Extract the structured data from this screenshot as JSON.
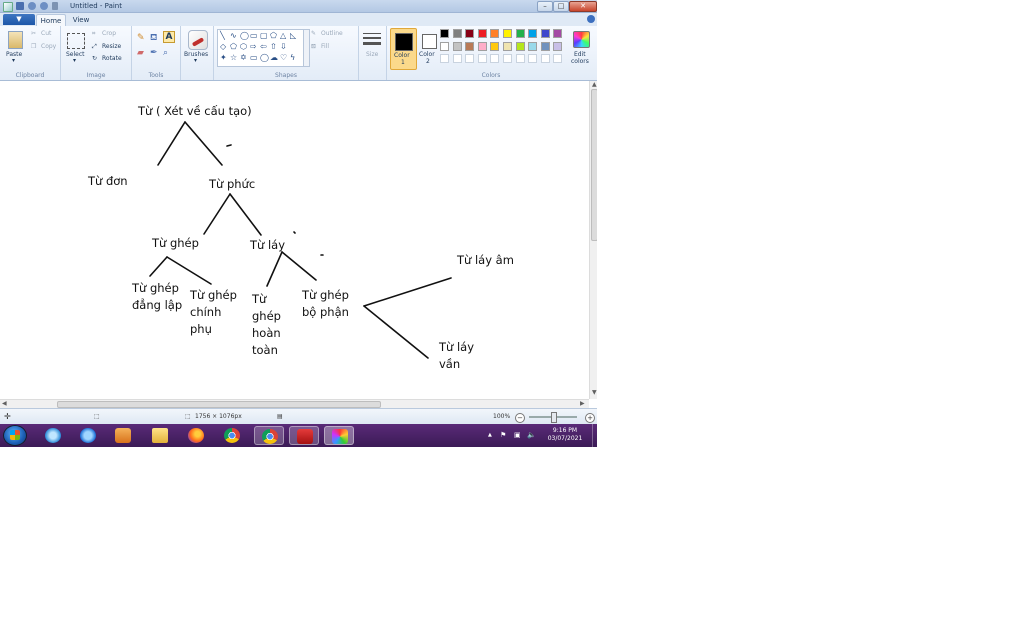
{
  "window": {
    "title": "Untitled - Paint",
    "controls": {
      "minimize": "–",
      "maximize": "□",
      "close": "✕"
    }
  },
  "tabs": {
    "file": "▼",
    "home": "Home",
    "view": "View"
  },
  "ribbon": {
    "clipboard": {
      "paste": "Paste",
      "cut": "Cut",
      "copy": "Copy",
      "group": "Clipboard"
    },
    "image": {
      "select": "Select",
      "crop": "Crop",
      "resize": "Resize",
      "rotate": "Rotate",
      "group": "Image"
    },
    "tools": {
      "group": "Tools",
      "text_tool": "A"
    },
    "brushes": {
      "label": "Brushes"
    },
    "shapes": {
      "outline": "Outline",
      "fill": "Fill",
      "group": "Shapes"
    },
    "size": {
      "label": "Size"
    },
    "colors": {
      "color1": "Color 1",
      "color2": "Color 2",
      "color1_lines": [
        "Color",
        "1"
      ],
      "color2_lines": [
        "Color",
        "2"
      ],
      "edit": "Edit colors",
      "edit_lines": [
        "Edit",
        "colors"
      ],
      "group": "Colors",
      "row1": [
        "#000000",
        "#7f7f7f",
        "#880015",
        "#ed1c24",
        "#ff7f27",
        "#fff200",
        "#22b14c",
        "#00a2e8",
        "#3f48cc",
        "#a349a4"
      ],
      "row2": [
        "#ffffff",
        "#c3c3c3",
        "#b97a57",
        "#ffaec9",
        "#ffc90e",
        "#efe4b0",
        "#b5e61d",
        "#99d9ea",
        "#7092be",
        "#c8bfe7"
      ],
      "active_color1": "#000000",
      "active_color2": "#ffffff"
    }
  },
  "canvas": {
    "texts": {
      "root": "Từ ( Xét về cấu tạo)",
      "tu_don": "Từ đơn",
      "tu_phuc": "Từ phức",
      "tu_ghep": "Từ ghép",
      "tu_lay": "Từ láy",
      "ghep_dang_lap": [
        "Từ ghép",
        "đẳng lập"
      ],
      "ghep_chinh_phu": [
        "Từ ghép",
        "chính",
        "phụ"
      ],
      "ghep_hoan_toan": [
        "Từ",
        "ghép",
        "hoàn",
        "toàn"
      ],
      "ghep_bo_phan": [
        "Từ ghép",
        "bộ phận"
      ],
      "lay_am": "Từ láy âm",
      "lay_van": [
        "Từ láy",
        "vần"
      ]
    }
  },
  "status": {
    "dimensions": "1756 × 1076px",
    "zoom": "100%",
    "zoom_minus": "−",
    "zoom_plus": "+"
  },
  "taskbar": {
    "time": "9:16 PM",
    "date": "03/07/2021",
    "tray_expand": "▲"
  }
}
